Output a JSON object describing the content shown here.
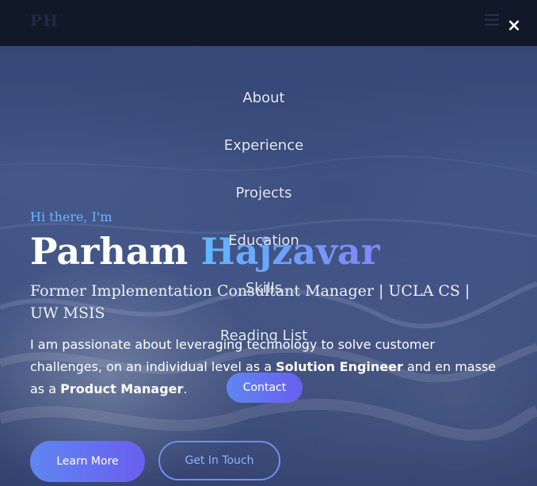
{
  "header": {
    "logo": "PH",
    "close_label": "×"
  },
  "hero": {
    "greeting": "Hi there, I'm",
    "first_name": "Parham",
    "last_name": "Hajzavar",
    "subtitle": "Former Implementation Consultant Manager | UCLA CS | UW MSIS",
    "bio_start": "I am passionate about leveraging technology to solve customer challenges, on an individual level as a ",
    "bio_role1": "Solution Engineer",
    "bio_mid": " and en masse as a ",
    "bio_role2": "Product Manager",
    "bio_end": ".",
    "learn_more_label": "Learn More",
    "get_in_touch_label": "Get In Touch"
  },
  "nav": {
    "items": [
      {
        "label": "About"
      },
      {
        "label": "Experience"
      },
      {
        "label": "Projects"
      },
      {
        "label": "Education"
      },
      {
        "label": "Skills"
      },
      {
        "label": "Reading List"
      }
    ],
    "contact_label": "Contact"
  },
  "colors": {
    "accent_blue": "#5fb8ff",
    "accent_violet": "#6a5ef0",
    "topbar": "#111827"
  }
}
